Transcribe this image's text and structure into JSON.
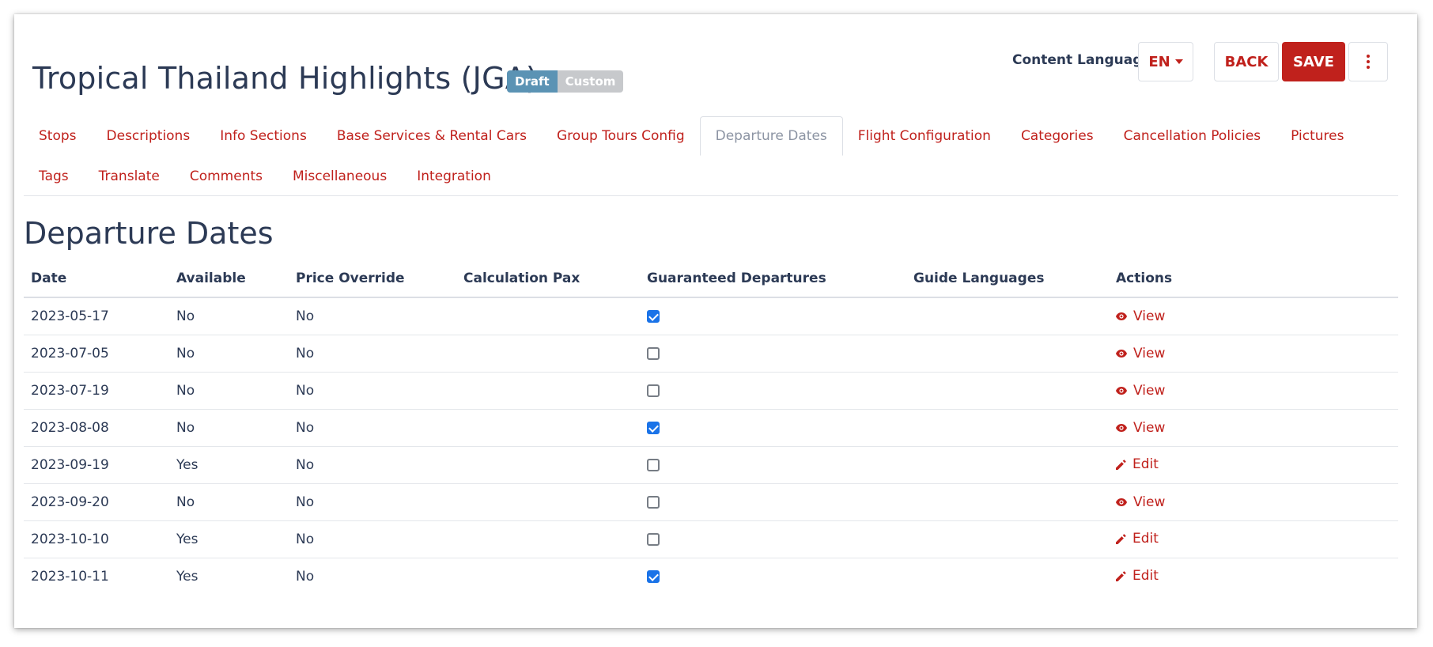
{
  "header": {
    "title": "Tropical Thailand Highlights (JGA)",
    "badges": [
      {
        "label": "Draft",
        "color": "#5b93b4"
      },
      {
        "label": "Custom",
        "color": "#c7c9cc"
      }
    ],
    "content_language_label": "Content Language",
    "language_value": "EN",
    "back_label": "BACK",
    "save_label": "SAVE"
  },
  "colors": {
    "accent": "#c0211c",
    "muted_tab": "#8c94a3",
    "checkbox_checked": "#1a73e8",
    "text": "#2c3a55"
  },
  "tabs": [
    {
      "label": "Stops",
      "active": false
    },
    {
      "label": "Descriptions",
      "active": false
    },
    {
      "label": "Info Sections",
      "active": false
    },
    {
      "label": "Base Services & Rental Cars",
      "active": false
    },
    {
      "label": "Group Tours Config",
      "active": false
    },
    {
      "label": "Departure Dates",
      "active": true
    },
    {
      "label": "Flight Configuration",
      "active": false
    },
    {
      "label": "Categories",
      "active": false
    },
    {
      "label": "Cancellation Policies",
      "active": false
    },
    {
      "label": "Pictures",
      "active": false
    },
    {
      "label": "Tags",
      "active": false
    },
    {
      "label": "Translate",
      "active": false
    },
    {
      "label": "Comments",
      "active": false
    },
    {
      "label": "Miscellaneous",
      "active": false
    },
    {
      "label": "Integration",
      "active": false
    }
  ],
  "section": {
    "title": "Departure Dates"
  },
  "table": {
    "columns": [
      "Date",
      "Available",
      "Price Override",
      "Calculation Pax",
      "Guaranteed Departures",
      "Guide Languages",
      "Actions"
    ],
    "rows": [
      {
        "date": "2023-05-17",
        "available": "No",
        "price_override": "No",
        "calculation_pax": "",
        "guaranteed": true,
        "guide_languages": "",
        "action": "View",
        "action_icon": "eye-icon"
      },
      {
        "date": "2023-07-05",
        "available": "No",
        "price_override": "No",
        "calculation_pax": "",
        "guaranteed": false,
        "guide_languages": "",
        "action": "View",
        "action_icon": "eye-icon"
      },
      {
        "date": "2023-07-19",
        "available": "No",
        "price_override": "No",
        "calculation_pax": "",
        "guaranteed": false,
        "guide_languages": "",
        "action": "View",
        "action_icon": "eye-icon"
      },
      {
        "date": "2023-08-08",
        "available": "No",
        "price_override": "No",
        "calculation_pax": "",
        "guaranteed": true,
        "guide_languages": "",
        "action": "View",
        "action_icon": "eye-icon"
      },
      {
        "date": "2023-09-19",
        "available": "Yes",
        "price_override": "No",
        "calculation_pax": "",
        "guaranteed": false,
        "guide_languages": "",
        "action": "Edit",
        "action_icon": "pencil-icon"
      },
      {
        "date": "2023-09-20",
        "available": "No",
        "price_override": "No",
        "calculation_pax": "",
        "guaranteed": false,
        "guide_languages": "",
        "action": "View",
        "action_icon": "eye-icon"
      },
      {
        "date": "2023-10-10",
        "available": "Yes",
        "price_override": "No",
        "calculation_pax": "",
        "guaranteed": false,
        "guide_languages": "",
        "action": "Edit",
        "action_icon": "pencil-icon"
      },
      {
        "date": "2023-10-11",
        "available": "Yes",
        "price_override": "No",
        "calculation_pax": "",
        "guaranteed": true,
        "guide_languages": "",
        "action": "Edit",
        "action_icon": "pencil-icon"
      }
    ]
  }
}
